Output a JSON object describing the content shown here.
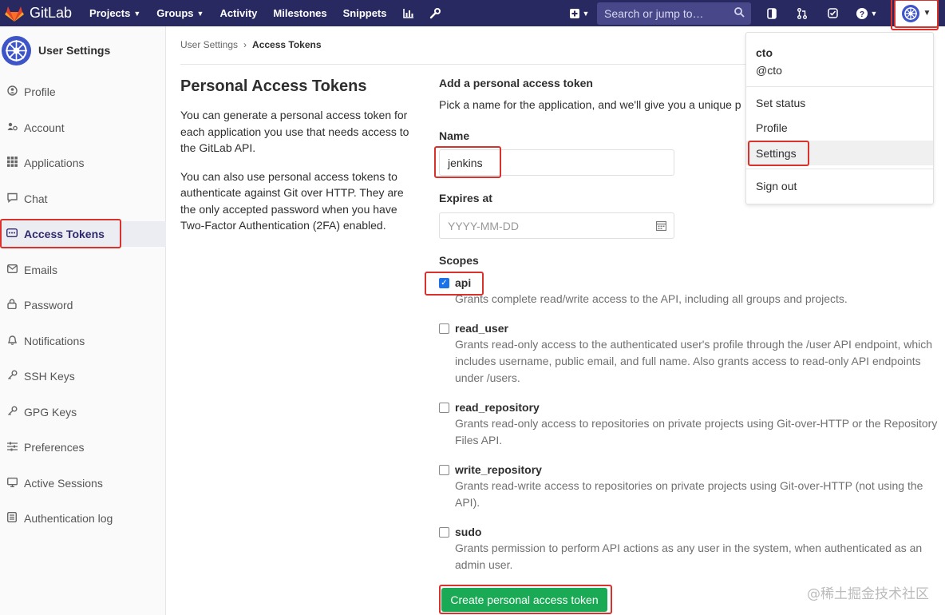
{
  "navbar": {
    "brand": "GitLab",
    "links": [
      {
        "label": "Projects",
        "has_caret": true
      },
      {
        "label": "Groups",
        "has_caret": true
      },
      {
        "label": "Activity",
        "has_caret": false
      },
      {
        "label": "Milestones",
        "has_caret": false
      },
      {
        "label": "Snippets",
        "has_caret": false
      }
    ],
    "search_placeholder": "Search or jump to…",
    "colors": {
      "bg": "#292961",
      "search_bg": "#47478a"
    }
  },
  "sidebar": {
    "title": "User Settings",
    "items": [
      {
        "label": "Profile",
        "icon": "profile-icon"
      },
      {
        "label": "Account",
        "icon": "account-icon"
      },
      {
        "label": "Applications",
        "icon": "applications-icon"
      },
      {
        "label": "Chat",
        "icon": "chat-icon"
      },
      {
        "label": "Access Tokens",
        "icon": "token-icon",
        "active": true
      },
      {
        "label": "Emails",
        "icon": "email-icon"
      },
      {
        "label": "Password",
        "icon": "lock-icon"
      },
      {
        "label": "Notifications",
        "icon": "bell-icon"
      },
      {
        "label": "SSH Keys",
        "icon": "key-icon"
      },
      {
        "label": "GPG Keys",
        "icon": "key-icon"
      },
      {
        "label": "Preferences",
        "icon": "sliders-icon"
      },
      {
        "label": "Active Sessions",
        "icon": "monitor-icon"
      },
      {
        "label": "Authentication log",
        "icon": "log-icon"
      }
    ]
  },
  "breadcrumb": {
    "parent": "User Settings",
    "current": "Access Tokens"
  },
  "intro": {
    "title": "Personal Access Tokens",
    "para1": "You can generate a personal access token for each application you use that needs access to the GitLab API.",
    "para2": "You can also use personal access tokens to authenticate against Git over HTTP. They are the only accepted password when you have Two-Factor Authentication (2FA) enabled."
  },
  "form": {
    "title": "Add a personal access token",
    "description": "Pick a name for the application, and we'll give you a unique p",
    "name_label": "Name",
    "name_value": "jenkins",
    "expires_label": "Expires at",
    "expires_placeholder": "YYYY-MM-DD",
    "scopes_label": "Scopes",
    "scopes": [
      {
        "name": "api",
        "checked": true,
        "desc": "Grants complete read/write access to the API, including all groups and projects."
      },
      {
        "name": "read_user",
        "checked": false,
        "desc": "Grants read-only access to the authenticated user's profile through the /user API endpoint, which includes username, public email, and full name. Also grants access to read-only API endpoints under /users."
      },
      {
        "name": "read_repository",
        "checked": false,
        "desc": "Grants read-only access to repositories on private projects using Git-over-HTTP or the Repository Files API."
      },
      {
        "name": "write_repository",
        "checked": false,
        "desc": "Grants read-write access to repositories on private projects using Git-over-HTTP (not using the API)."
      },
      {
        "name": "sudo",
        "checked": false,
        "desc": "Grants permission to perform API actions as any user in the system, when authenticated as an admin user."
      }
    ],
    "submit_label": "Create personal access token"
  },
  "user_dropdown": {
    "name": "cto",
    "handle": "@cto",
    "items": [
      "Set status",
      "Profile",
      "Settings",
      "Sign out"
    ]
  },
  "watermark": "@稀土掘金技术社区",
  "highlight_color": "#d9312b"
}
